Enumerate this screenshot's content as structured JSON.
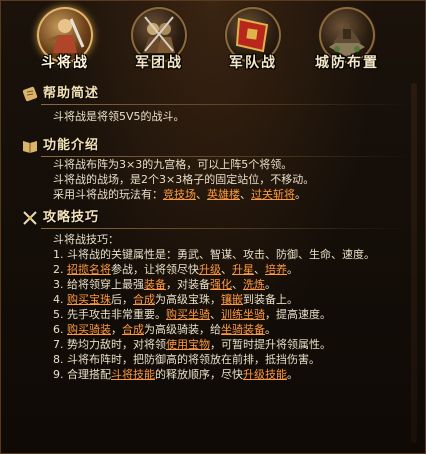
{
  "tabs": [
    {
      "label": "斗将战",
      "icon": "general-warrior-icon",
      "active": true
    },
    {
      "label": "军团战",
      "icon": "legion-battle-icon",
      "active": false
    },
    {
      "label": "军队战",
      "icon": "army-banner-icon",
      "active": false
    },
    {
      "label": "城防布置",
      "icon": "city-defense-icon",
      "active": false
    }
  ],
  "help": {
    "title": "帮助简述",
    "text": "斗将战是将领5V5的战斗。"
  },
  "features": {
    "title": "功能介绍",
    "line1": "斗将战布阵为3×3的九宫格，可以上阵5个将领。",
    "line2": "斗将战的战场，是2个3×3格子的固定站位，不移动。",
    "line3_prefix": "采用斗将战的玩法有：",
    "links": [
      "竞技场",
      "英雄楼",
      "过关斩将"
    ],
    "sep": "、",
    "end": "。"
  },
  "tips": {
    "title": "攻略技巧",
    "intro": "斗将战技巧：",
    "items": [
      {
        "num": "1.",
        "parts": [
          {
            "t": "斗将战的关键属性是：勇武、智谋、攻击、防御、生命、速度。"
          }
        ]
      },
      {
        "num": "2.",
        "parts": [
          {
            "t": "招揽名将",
            "link": true
          },
          {
            "t": "参战，让将领尽快"
          },
          {
            "t": "升级",
            "link": true
          },
          {
            "t": "、"
          },
          {
            "t": "升星",
            "link": true
          },
          {
            "t": "、"
          },
          {
            "t": "培养",
            "link": true
          },
          {
            "t": "。"
          }
        ]
      },
      {
        "num": "3.",
        "parts": [
          {
            "t": "给将领穿上最强"
          },
          {
            "t": "装备",
            "link": true
          },
          {
            "t": "，对装备"
          },
          {
            "t": "强化",
            "link": true
          },
          {
            "t": "、"
          },
          {
            "t": "洗炼",
            "link": true
          },
          {
            "t": "。"
          }
        ]
      },
      {
        "num": "4.",
        "parts": [
          {
            "t": "购买宝珠",
            "link": true
          },
          {
            "t": "后，"
          },
          {
            "t": "合成",
            "link": true
          },
          {
            "t": "为高级宝珠，"
          },
          {
            "t": "镶嵌",
            "link": true
          },
          {
            "t": "到装备上。"
          }
        ]
      },
      {
        "num": "5.",
        "parts": [
          {
            "t": "先手攻击非常重要。"
          },
          {
            "t": "购买坐骑",
            "link": true
          },
          {
            "t": "、"
          },
          {
            "t": "训练坐骑",
            "link": true
          },
          {
            "t": "，提高速度。"
          }
        ]
      },
      {
        "num": "6.",
        "parts": [
          {
            "t": "购买骑装",
            "link": true
          },
          {
            "t": "，"
          },
          {
            "t": "合成",
            "link": true
          },
          {
            "t": "为高级骑装，给"
          },
          {
            "t": "坐骑装备",
            "link": true
          },
          {
            "t": "。"
          }
        ]
      },
      {
        "num": "7.",
        "parts": [
          {
            "t": "势均力敌时，对将领"
          },
          {
            "t": "使用宝物",
            "link": true
          },
          {
            "t": "，可暂时提升将领属性。"
          }
        ]
      },
      {
        "num": "8.",
        "parts": [
          {
            "t": "斗将布阵时，把防御高的将领放在前排，抵挡伤害。"
          }
        ]
      },
      {
        "num": "9.",
        "parts": [
          {
            "t": "合理搭配"
          },
          {
            "t": "斗将技能",
            "link": true
          },
          {
            "t": "的释放顺序，尽快"
          },
          {
            "t": "升级技能",
            "link": true
          },
          {
            "t": "。"
          }
        ]
      }
    ]
  },
  "colors": {
    "link": "#ff9a3c",
    "text": "#e9dfc8",
    "title": "#f4e2b8",
    "accent": "#e3b768"
  }
}
